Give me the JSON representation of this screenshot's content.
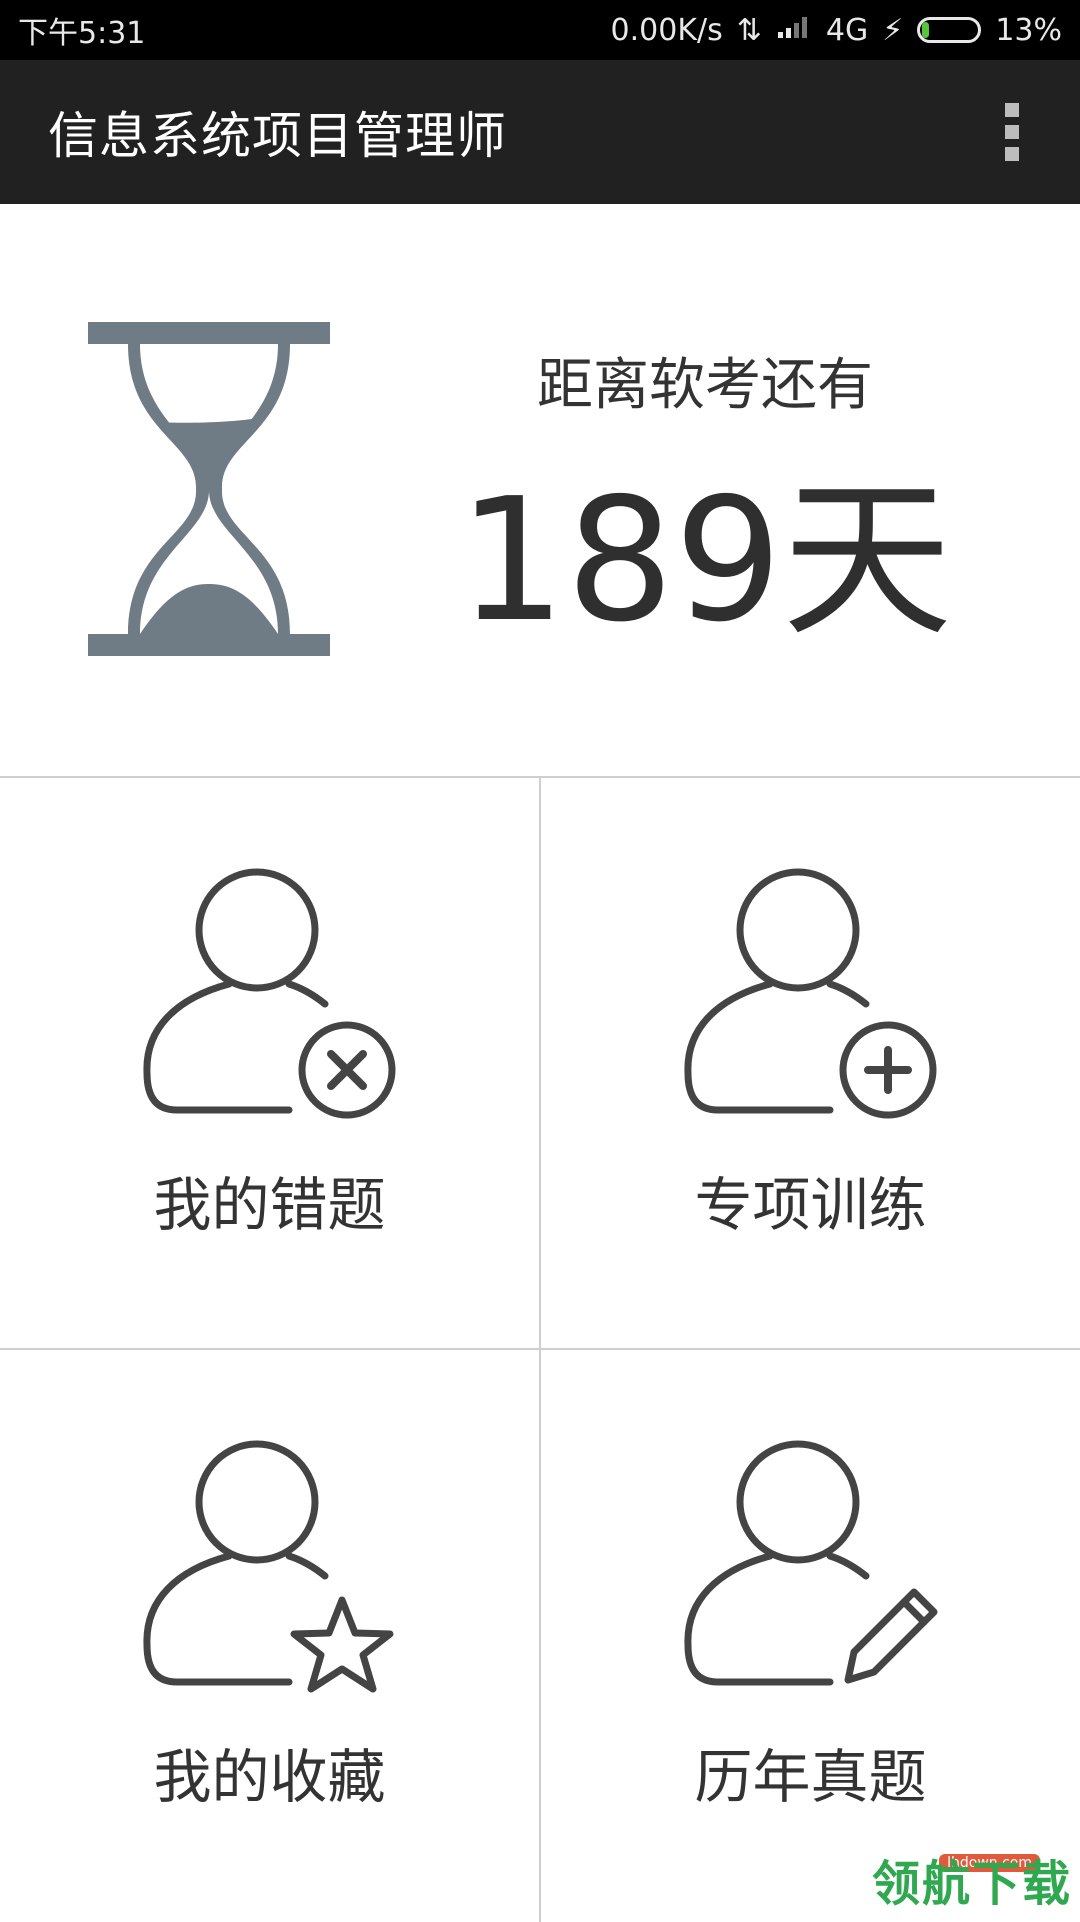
{
  "status_bar": {
    "time": "下午5:31",
    "network_speed": "0.00K/s",
    "network_type": "4G",
    "battery_percent_text": "13%",
    "battery_level": 0.13
  },
  "app_bar": {
    "title": "信息系统项目管理师",
    "menu_icon": "overflow-menu-icon"
  },
  "countdown": {
    "label": "距离软考还有",
    "value": "189天",
    "icon": "hourglass-icon"
  },
  "grid": {
    "items": [
      {
        "label": "我的错题",
        "icon": "user-remove-icon"
      },
      {
        "label": "专项训练",
        "icon": "user-add-icon"
      },
      {
        "label": "我的收藏",
        "icon": "user-star-icon"
      },
      {
        "label": "历年真题",
        "icon": "user-edit-icon"
      }
    ]
  },
  "watermark": {
    "text": "领航下载",
    "sub": "lhdown.com"
  },
  "colors": {
    "app_bar": "#212121",
    "status_bar": "#000000",
    "icon_gray": "#6f7b85",
    "icon_dark": "#444444",
    "battery_green": "#5ac53a"
  }
}
